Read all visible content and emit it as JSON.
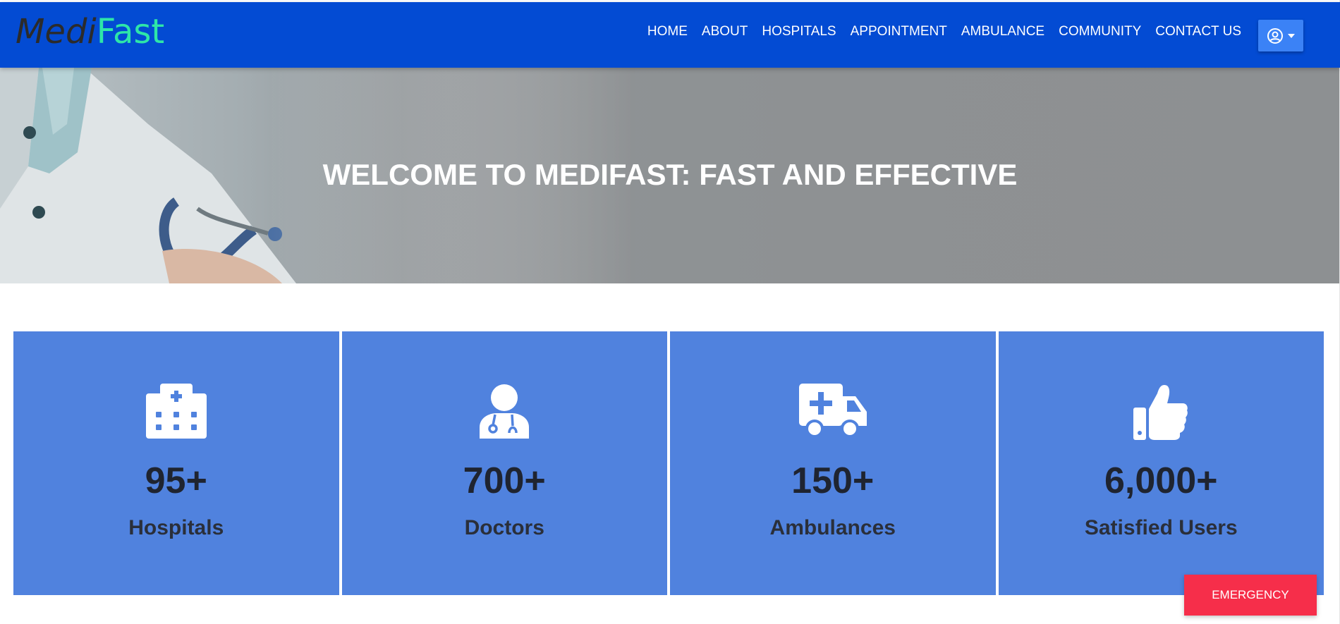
{
  "brand": {
    "part1": "Medi",
    "part2": "Fast"
  },
  "nav": {
    "items": [
      {
        "label": "HOME"
      },
      {
        "label": "ABOUT"
      },
      {
        "label": "HOSPITALS"
      },
      {
        "label": "APPOINTMENT"
      },
      {
        "label": "AMBULANCE"
      },
      {
        "label": "COMMUNITY"
      },
      {
        "label": "CONTACT US"
      }
    ],
    "user_icon": "user-circle-icon"
  },
  "hero": {
    "title": "WELCOME TO MEDIFAST: FAST AND EFFECTIVE"
  },
  "stats": [
    {
      "icon": "hospital-icon",
      "number": "95+",
      "label": "Hospitals"
    },
    {
      "icon": "doctor-icon",
      "number": "700+",
      "label": "Doctors"
    },
    {
      "icon": "ambulance-icon",
      "number": "150+",
      "label": "Ambulances"
    },
    {
      "icon": "thumbs-up-icon",
      "number": "6,000+",
      "label": "Satisfied Users"
    }
  ],
  "emergency": {
    "label": "EMERGENCY"
  },
  "colors": {
    "navbar": "#034bd3",
    "card": "#5082de",
    "brand_accent": "#2ee6a8",
    "emergency": "#f62e4a"
  }
}
